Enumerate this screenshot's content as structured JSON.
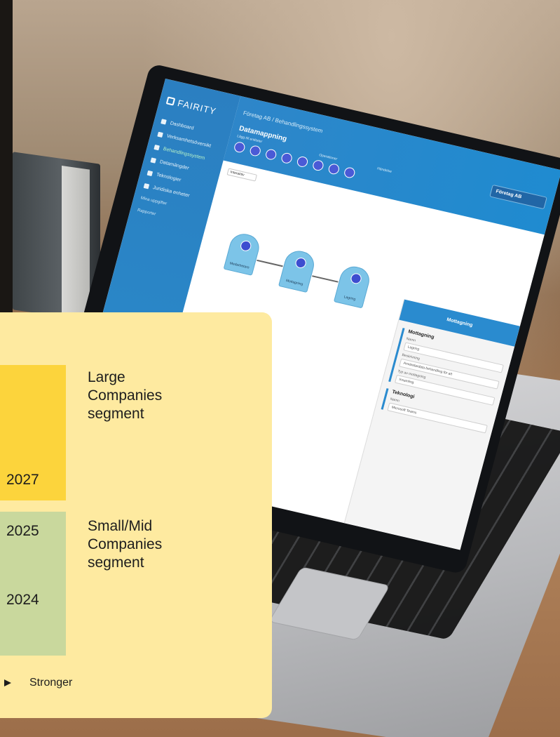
{
  "app": {
    "brand": "FAIRITY",
    "breadcrumb": "Företag AB / Behandlingssystem",
    "title": "Datamappning",
    "toolbar_group_1": "Lägg till entiteter",
    "toolbar_group_2": "Operationer",
    "toolbar_group_3": "Händelse",
    "company": "Företag AB",
    "canvas_mode": "Interaktiv",
    "sidebar": [
      {
        "label": "Dashboard",
        "active": false
      },
      {
        "label": "Verksamhetsöversikt",
        "active": false
      },
      {
        "label": "Behandlingssystem",
        "active": true
      },
      {
        "label": "Datamängder",
        "active": false
      },
      {
        "label": "Teknologier",
        "active": false
      },
      {
        "label": "Juridiska enheter",
        "active": false
      }
    ],
    "sidebar_small": [
      "Mina uppgifter",
      "Rapporter"
    ],
    "nodes": [
      {
        "label": "Medarbetare"
      },
      {
        "label": "Mottagning"
      },
      {
        "label": "Lagring"
      }
    ],
    "panel": {
      "title": "Mottagning",
      "section_1": "Mottagning",
      "name_label": "Namn",
      "name_value": "Lagring",
      "description_label": "Beskrivning",
      "description_value": "Användardata behandling för att",
      "source_label": "Typ av mottagning",
      "source_value": "Insamling",
      "section_2": "Teknologi",
      "tech_label": "Namn",
      "tech_value": "Microsoft Teams"
    }
  },
  "overlay": {
    "large_year": "2027",
    "large_segment": [
      "Large",
      "Companies",
      "segment"
    ],
    "small_year_top": "2025",
    "small_year_bottom": "2024",
    "small_segment": [
      "Small/Mid",
      "Companies",
      "segment"
    ],
    "axis_label": "Stronger"
  },
  "colors": {
    "overlay_bg": "#feeaa0",
    "large_block": "#fcd43c",
    "small_block": "#c9d89d",
    "app_blue": "#2a86c7"
  }
}
